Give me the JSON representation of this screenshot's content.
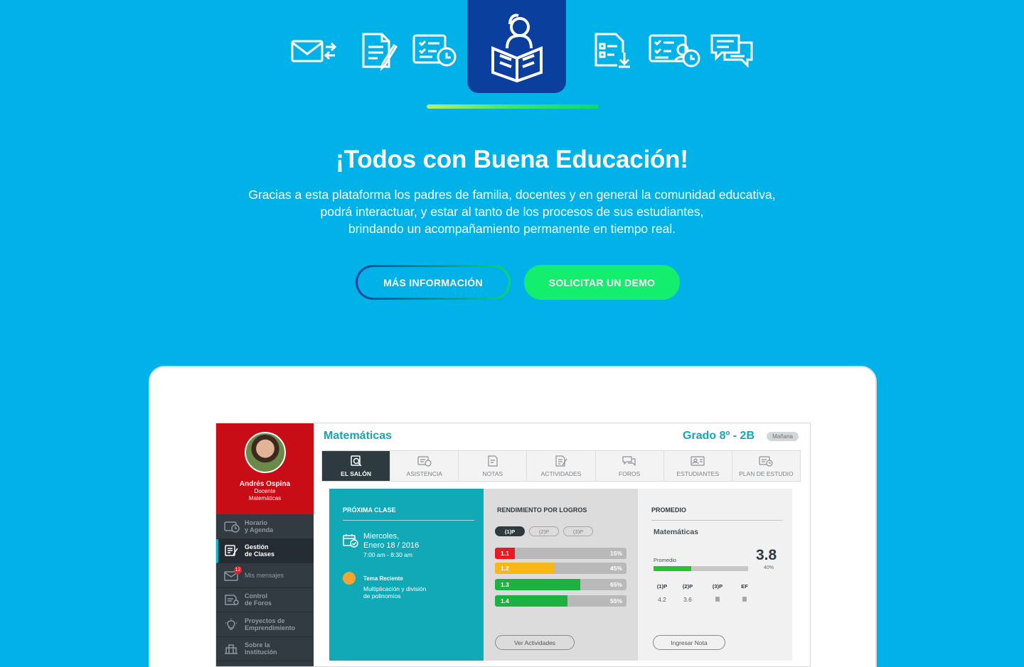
{
  "hero": {
    "title": "¡Todos con Buena Educación!",
    "text_lines": [
      "Gracias a esta plataforma los padres de familia, docentes y en general la comunidad educativa,",
      "podrá interactuar, y estar al tanto de los procesos de sus estudiantes,",
      "brindando un acompañamiento permanente en tiempo real."
    ],
    "btn_info": "MÁS INFORMACIÓN",
    "btn_demo": "SOLICITAR UN DEMO"
  },
  "top_icons": [
    "mail-exchange-icon",
    "document-edit-icon",
    "form-clock-icon",
    "reader-book-icon",
    "list-download-icon",
    "checklist-user-clock-icon",
    "chat-bubbles-icon"
  ],
  "colors": {
    "background": "#00b2e7",
    "featured": "#0a3f9e",
    "accent_green": "#14ee6e",
    "sidebar_red": "#c80d16",
    "teal": "#1aa3b3"
  },
  "app": {
    "profile": {
      "name": "Andrés Ospina",
      "role": "Docente",
      "subject": "Matemáticas"
    },
    "sidebar": [
      {
        "label": "Horario\ny Agenda",
        "icon": "calendar-icon"
      },
      {
        "label": "Gestión\nde Clases",
        "icon": "class-management-icon",
        "active": true
      },
      {
        "label": "Mis mensajes",
        "icon": "mail-icon",
        "badge": "12"
      },
      {
        "label": "Control\nde Foros",
        "icon": "forum-control-icon"
      },
      {
        "label": "Proyectos de\nEmprendimiento",
        "icon": "lightbulb-icon"
      },
      {
        "label": "Sobre la\ninstitución",
        "icon": "building-icon"
      }
    ],
    "subject": "Matemáticas",
    "grade": "Grado 8º - 2B",
    "shift": "Mañana",
    "tabs": [
      {
        "label": "EL SALÓN",
        "icon": "search-doc-icon",
        "active": true
      },
      {
        "label": "ASISTENCIA",
        "icon": "attendance-icon"
      },
      {
        "label": "NOTAS",
        "icon": "grades-icon"
      },
      {
        "label": "ACTIVIDADES",
        "icon": "activities-icon"
      },
      {
        "label": "FOROS",
        "icon": "forums-icon"
      },
      {
        "label": "ESTUDIANTES",
        "icon": "students-icon"
      },
      {
        "label": "PLAN DE ESTUDIO",
        "icon": "study-plan-icon"
      }
    ],
    "next_class": {
      "heading": "PRÓXIMA CLASE",
      "date_line1": "Miercoles,",
      "date_line2": "Enero 18 / 2016",
      "time": "7:00 am - 8:30 am",
      "topic_label": "Tema Reciente",
      "topic_line1": "Multiplicación y división",
      "topic_line2": "de polinomios"
    },
    "rendimiento": {
      "heading": "RENDIMIENTO POR LOGROS",
      "periods": [
        "(1)P",
        "(2)P",
        "(3)P"
      ],
      "active_period": 0,
      "bars": [
        {
          "label": "1.1",
          "pct": 15,
          "pct_label": "15%",
          "color": "#e51c23"
        },
        {
          "label": "1.2",
          "pct": 45,
          "pct_label": "45%",
          "color": "#f7b719"
        },
        {
          "label": "1.3",
          "pct": 65,
          "pct_label": "65%",
          "color": "#1db141"
        },
        {
          "label": "1.4",
          "pct": 55,
          "pct_label": "55%",
          "color": "#1db141"
        }
      ],
      "button": "Ver Actividades"
    },
    "promedio": {
      "heading": "PROMEDIO",
      "subject": "Matemáticas",
      "label": "Promedio",
      "score": "3.8",
      "pct_label": "40%",
      "pct": 40,
      "columns": [
        {
          "h": "(1)P",
          "v": "4.2"
        },
        {
          "h": "(2)P",
          "v": "3.6"
        },
        {
          "h": "(3)P",
          "v": null
        },
        {
          "h": "EF",
          "v": null
        }
      ],
      "button": "Ingresar Nota"
    }
  }
}
